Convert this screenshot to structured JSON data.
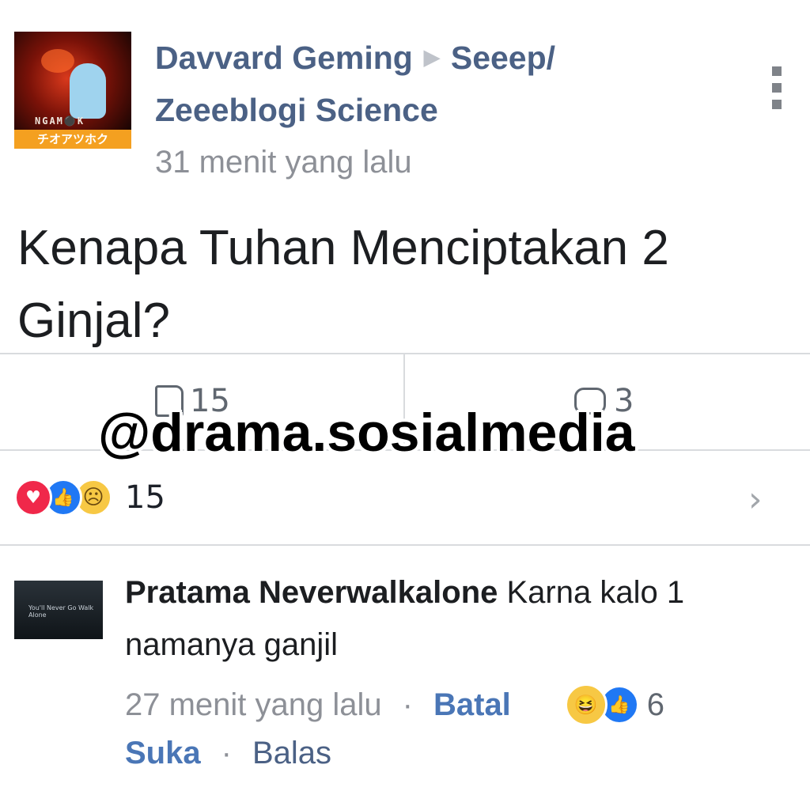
{
  "post": {
    "author": "Davvard Geming",
    "group": "Seeep/",
    "group_line2": "Zeeeblogi Science",
    "time": "31 menit yang lalu",
    "text": "Kenapa Tuhan Menciptakan 2 Ginjal?",
    "avatar_text_top": "NGAM⚫K",
    "avatar_text_bottom": "チオアツホク",
    "like_count": "15",
    "comment_count": "3"
  },
  "watermark": "@drama.sosialmedia",
  "reactions": {
    "icons": [
      "heart-icon",
      "like-icon",
      "sad-icon"
    ],
    "count": "15"
  },
  "comment": {
    "name": "Pratama Neverwalkalone",
    "text": " Karna kalo 1 namanya ganjil",
    "time": "27 menit yang lalu",
    "cancel_label": "Batal",
    "reaction_count": "6",
    "like_label": "Suka",
    "reply_label": "Balas",
    "avatar_text": "You'll Never Go Walk Alone"
  },
  "colors": {
    "header_blue": "#4b6185",
    "link_blue": "#4a76b6",
    "love": "#f0284a",
    "like": "#2078f4",
    "emoji_yellow": "#f7c844"
  }
}
